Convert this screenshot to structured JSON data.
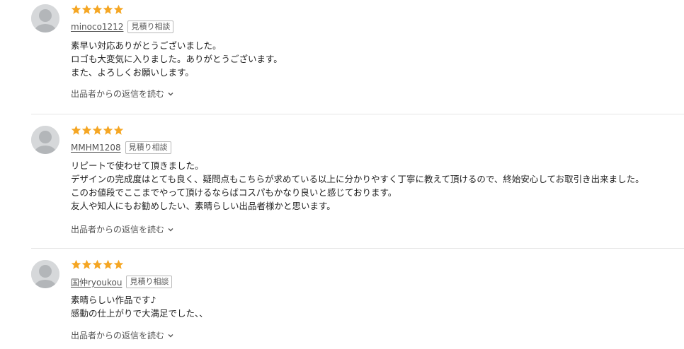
{
  "badge_label": "見積り相談",
  "reply_label": "出品者からの返信を読む",
  "star_color": "#f5a623",
  "reviews": [
    {
      "rating": 5,
      "username": "minoco1212",
      "lines": [
        "素早い対応ありがとうございました。",
        "ロゴも大変気に入りました。ありがとうございます。",
        "また、よろしくお願いします。"
      ]
    },
    {
      "rating": 5,
      "username": "MMHM1208",
      "lines": [
        "リピートで使わせて頂きました。",
        "デザインの完成度はとても良く、疑問点もこちらが求めている以上に分かりやすく丁寧に教えて頂けるので、終始安心してお取引き出来ました。",
        "このお値段でここまでやって頂けるならばコスパもかなり良いと感じております。",
        "友人や知人にもお勧めしたい、素晴らしい出品者様かと思います。"
      ]
    },
    {
      "rating": 5,
      "username": "国仲ryoukou",
      "lines": [
        "素晴らしい作品です♪",
        "感動の仕上がりで大満足でした、、"
      ]
    }
  ]
}
